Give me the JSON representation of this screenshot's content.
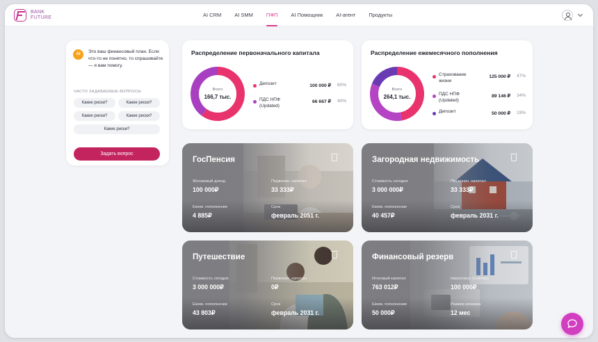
{
  "header": {
    "logo_line1": "BANK",
    "logo_line2": "FUTURE",
    "nav": [
      "AI CRM",
      "AI SMM",
      "ПФП",
      "AI Помощник",
      "AI-агент",
      "Продукты"
    ],
    "active_nav": "ПФП"
  },
  "chat": {
    "avatar": "AI",
    "message": "Это ваш финансовый план. Если что-то не понятно, то спрашивайте — я вам помогу.",
    "faq_title": "ЧАСТО ЗАДАВАЕМЫЕ ВОПРОСЫ",
    "faq": [
      "Какие риски?",
      "Какие риски?",
      "Какие риски?",
      "Какие риски?",
      "Какие риски?"
    ],
    "ask_button": "Задать вопрос"
  },
  "distributions": [
    {
      "title": "Распределение первоначального капитала",
      "total_label": "Всего",
      "total_value": "166,7 тыс.",
      "items": [
        {
          "name": "Депозит",
          "amount": "100 000 ₽",
          "pct": "60%",
          "share": 0.6,
          "color": "#e8336d"
        },
        {
          "name": "ПДС НПФ (Updated)",
          "amount": "66 667 ₽",
          "pct": "40%",
          "share": 0.4,
          "color": "#a83fc0"
        }
      ]
    },
    {
      "title": "Распределение ежемесячного пополнения",
      "total_label": "Всего",
      "total_value": "264,1 тыс.",
      "items": [
        {
          "name": "Страхование жизни",
          "amount": "125 000 ₽",
          "pct": "47%",
          "share": 0.47,
          "color": "#e8336d"
        },
        {
          "name": "ПДС НПФ (Updated)",
          "amount": "89 146 ₽",
          "pct": "34%",
          "share": 0.34,
          "color": "#b544c4"
        },
        {
          "name": "Депозит",
          "amount": "50 000 ₽",
          "pct": "19%",
          "share": 0.19,
          "color": "#6a3ab2"
        }
      ]
    }
  ],
  "goals": [
    {
      "title": "ГосПенсия",
      "top_left_label": "Желаемый доход",
      "top_left_value": "100 000₽",
      "top_right_label": "Первонач. капитал",
      "top_right_value": "33 333₽",
      "bottom_left_label": "Ежем. пополнение",
      "bottom_left_value": "4 885₽",
      "bottom_right_label": "Срок",
      "bottom_right_value": "февраль 2051 г."
    },
    {
      "title": "Загородная недвижимость",
      "top_left_label": "Стоимость сегодня",
      "top_left_value": "3 000 000₽",
      "top_right_label": "Первонач. капитал",
      "top_right_value": "33 333₽",
      "bottom_left_label": "Ежем. пополнение",
      "bottom_left_value": "40 457₽",
      "bottom_right_label": "Срок",
      "bottom_right_value": "февраль 2031 г."
    },
    {
      "title": "Путешествие",
      "top_left_label": "Стоимость сегодня",
      "top_left_value": "3 000 000₽",
      "top_right_label": "Первонач. капитал",
      "top_right_value": "0₽",
      "bottom_left_label": "Ежем. пополнение",
      "bottom_left_value": "43 803₽",
      "bottom_right_label": "Срок",
      "bottom_right_value": "февраль 2031 г."
    },
    {
      "title": "Финансовый резерв",
      "top_left_label": "Итоговый капитал",
      "top_left_value": "763 012₽",
      "top_right_label": "Накоплено (Сейчас)",
      "top_right_value": "100 000₽",
      "bottom_left_label": "Ежем. пополнение",
      "bottom_left_value": "50 000₽",
      "bottom_right_label": "Размер резерва",
      "bottom_right_value": "12 мес"
    }
  ],
  "colors": {
    "accent": "#d43a8e",
    "button": "#c4245e",
    "fab": "#d23ec0"
  }
}
